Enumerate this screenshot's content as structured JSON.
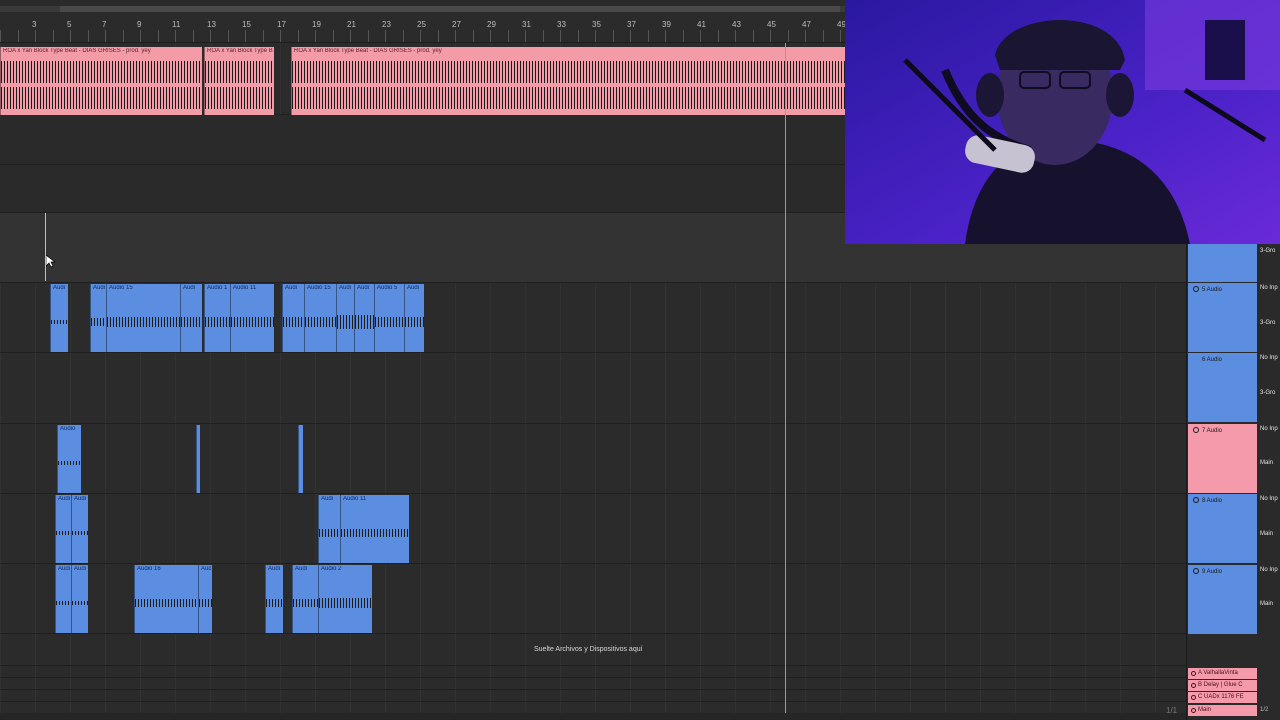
{
  "ruler": {
    "numbers": [
      "3",
      "5",
      "7",
      "9",
      "11",
      "13",
      "15",
      "17",
      "19",
      "21",
      "23",
      "25",
      "27",
      "29",
      "31",
      "33",
      "35",
      "37",
      "39",
      "41",
      "43",
      "45",
      "47",
      "49"
    ]
  },
  "tracks": {
    "pink_track": {
      "clips": [
        {
          "label": "ROA x Yan Block Type Beat - DIAS GRISES - prod. yey"
        },
        {
          "label": "ROA x Yan Block Type Beat"
        },
        {
          "label": "ROA x Yan Block Type Beat - DIAS GRISES - prod. yey"
        }
      ]
    },
    "track5": {
      "clips": [
        {
          "label": "Audi"
        },
        {
          "label": "Audi"
        },
        {
          "label": "Audio 15"
        },
        {
          "label": "Audi"
        },
        {
          "label": "Audio 1"
        },
        {
          "label": "Audio 11"
        },
        {
          "label": "Audi"
        },
        {
          "label": "Audio 15"
        },
        {
          "label": "Audi"
        },
        {
          "label": "Audi"
        },
        {
          "label": "Audio 5"
        },
        {
          "label": "Audi"
        }
      ]
    },
    "track7": {
      "clips": [
        {
          "label": "Audio"
        },
        {
          "label": ""
        },
        {
          "label": ""
        }
      ]
    },
    "track8": {
      "clips": [
        {
          "label": "Audi"
        },
        {
          "label": "Audi"
        },
        {
          "label": "Audi"
        },
        {
          "label": "Audio 11"
        }
      ]
    },
    "track9": {
      "clips": [
        {
          "label": "Audi"
        },
        {
          "label": "Audi"
        },
        {
          "label": "Audio 16"
        },
        {
          "label": "Audi"
        },
        {
          "label": "Audi"
        },
        {
          "label": "Audi"
        },
        {
          "label": "Audio 2"
        }
      ]
    }
  },
  "drop_zone": "Suelte Archivos y Dispositivos aquí",
  "mixer": {
    "top_label": "3-Gro",
    "tracks": [
      {
        "name": "5 Audio",
        "input": "No Inp",
        "output": "3-Gro"
      },
      {
        "name": "6 Audio",
        "input": "No Inp",
        "output": "3-Gro"
      },
      {
        "name": "7 Audio",
        "input": "No Inp",
        "output": "Main"
      },
      {
        "name": "8 Audio",
        "input": "No Inp",
        "output": "Main"
      },
      {
        "name": "9 Audio",
        "input": "No Inp",
        "output": "Main"
      }
    ],
    "returns": [
      {
        "name": "A ValhallaVinta"
      },
      {
        "name": "B Delay | Glue C"
      },
      {
        "name": "C UADx 1176 FE"
      },
      {
        "name": "Main"
      }
    ],
    "page_indicator": "1/1",
    "main_counter": "1/2"
  },
  "colors": {
    "pink": "#f49ba8",
    "blue": "#5b8de0",
    "background": "#2b2b2b",
    "webcam_purple": "#3a1fb0"
  }
}
